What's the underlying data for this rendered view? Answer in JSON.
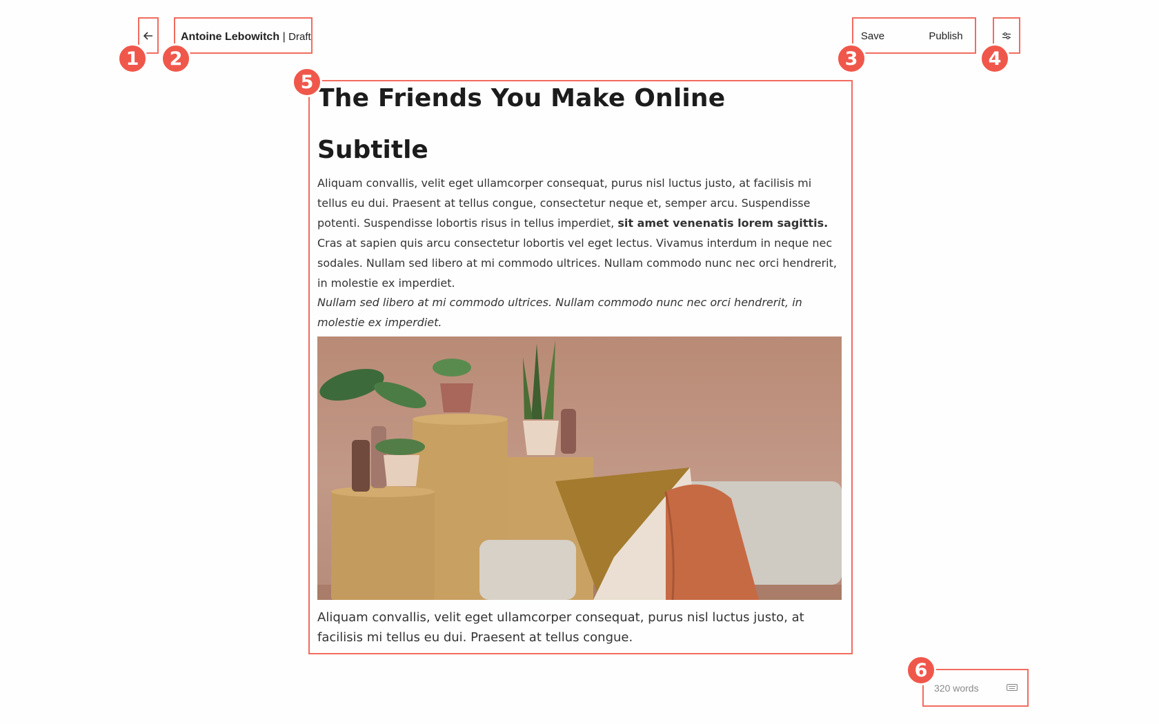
{
  "header": {
    "back_icon": "arrow-left-icon",
    "author": "Antoine Lebowitch",
    "separator": "|",
    "status": "Draft",
    "save_label": "Save",
    "publish_label": "Publish",
    "settings_icon": "sliders-icon"
  },
  "markers": [
    "1",
    "2",
    "3",
    "4",
    "5",
    "6"
  ],
  "article": {
    "title": "The Friends You Make Online",
    "subtitle": "Subtitle",
    "p1_before_bold": "Aliquam convallis, velit eget ullamcorper consequat, purus nisl luctus justo, at facilisis mi tellus eu dui. Praesent at tellus congue, consectetur neque et, semper arcu. Suspendisse potenti. Suspendisse lobortis risus in tellus imperdiet, ",
    "p1_bold": "sit amet venenatis lorem sagittis.",
    "p1_after_bold": " Cras at sapien quis arcu consectetur lobortis vel eget lectus. Vivamus interdum in neque nec sodales. Nullam sed libero at mi commodo ultrices. Nullam commodo nunc nec orci hendrerit, in molestie ex imperdiet.",
    "quote": "Nullam sed libero at mi commodo ultrices. Nullam commodo nunc nec orci hendrerit, in molestie ex imperdiet.",
    "caption": "Aliquam convallis, velit eget ullamcorper consequat, purus nisl luctus justo, at facilisis mi tellus eu dui. Praesent at tellus congue."
  },
  "footer": {
    "word_count": "320 words",
    "keyboard_icon": "keyboard-icon"
  },
  "colors": {
    "highlight": "#f26b5e",
    "marker": "#f0574b"
  }
}
